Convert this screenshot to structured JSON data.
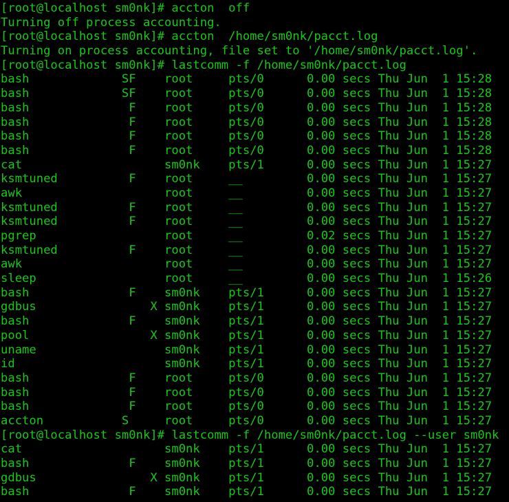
{
  "colors": {
    "background": "#000000",
    "text": "#17c917"
  },
  "prompt": "[root@localhost sm0nk]# ",
  "blocks": [
    {
      "type": "cmd",
      "text": "accton  off"
    },
    {
      "type": "out",
      "text": "Turning off process accounting."
    },
    {
      "type": "cmd",
      "text": "accton  /home/sm0nk/pacct.log"
    },
    {
      "type": "out",
      "text": "Turning on process accounting, file set to '/home/sm0nk/pacct.log'."
    },
    {
      "type": "cmd",
      "text": "lastcomm -f /home/sm0nk/pacct.log"
    },
    {
      "type": "rows",
      "rows": [
        [
          "bash",
          "SF",
          "root",
          "pts/0",
          "0.00",
          "Thu Jun  1 15:28"
        ],
        [
          "bash",
          "SF",
          "root",
          "pts/0",
          "0.00",
          "Thu Jun  1 15:28"
        ],
        [
          "bash",
          " F",
          "root",
          "pts/0",
          "0.00",
          "Thu Jun  1 15:28"
        ],
        [
          "bash",
          " F",
          "root",
          "pts/0",
          "0.00",
          "Thu Jun  1 15:28"
        ],
        [
          "bash",
          " F",
          "root",
          "pts/0",
          "0.00",
          "Thu Jun  1 15:28"
        ],
        [
          "bash",
          " F",
          "root",
          "pts/0",
          "0.00",
          "Thu Jun  1 15:28"
        ],
        [
          "cat",
          "",
          "sm0nk",
          "pts/1",
          "0.00",
          "Thu Jun  1 15:27"
        ],
        [
          "ksmtuned",
          " F",
          "root",
          "__",
          "0.00",
          "Thu Jun  1 15:27"
        ],
        [
          "awk",
          "",
          "root",
          "__",
          "0.00",
          "Thu Jun  1 15:27"
        ],
        [
          "ksmtuned",
          " F",
          "root",
          "__",
          "0.00",
          "Thu Jun  1 15:27"
        ],
        [
          "ksmtuned",
          " F",
          "root",
          "__",
          "0.00",
          "Thu Jun  1 15:27"
        ],
        [
          "pgrep",
          "",
          "root",
          "__",
          "0.02",
          "Thu Jun  1 15:27"
        ],
        [
          "ksmtuned",
          " F",
          "root",
          "__",
          "0.00",
          "Thu Jun  1 15:27"
        ],
        [
          "awk",
          "",
          "root",
          "__",
          "0.00",
          "Thu Jun  1 15:27"
        ],
        [
          "sleep",
          "",
          "root",
          "__",
          "0.00",
          "Thu Jun  1 15:26"
        ],
        [
          "bash",
          " F",
          "sm0nk",
          "pts/1",
          "0.00",
          "Thu Jun  1 15:27"
        ],
        [
          "gdbus",
          "    X",
          "sm0nk",
          "pts/1",
          "0.00",
          "Thu Jun  1 15:27"
        ],
        [
          "bash",
          " F",
          "sm0nk",
          "pts/1",
          "0.00",
          "Thu Jun  1 15:27"
        ],
        [
          "pool",
          "    X",
          "sm0nk",
          "pts/1",
          "0.00",
          "Thu Jun  1 15:27"
        ],
        [
          "uname",
          "",
          "sm0nk",
          "pts/1",
          "0.00",
          "Thu Jun  1 15:27"
        ],
        [
          "id",
          "",
          "sm0nk",
          "pts/1",
          "0.00",
          "Thu Jun  1 15:27"
        ],
        [
          "bash",
          " F",
          "root",
          "pts/0",
          "0.00",
          "Thu Jun  1 15:27"
        ],
        [
          "bash",
          " F",
          "root",
          "pts/0",
          "0.00",
          "Thu Jun  1 15:27"
        ],
        [
          "bash",
          " F",
          "root",
          "pts/0",
          "0.00",
          "Thu Jun  1 15:27"
        ],
        [
          "accton",
          "S",
          "root",
          "pts/0",
          "0.00",
          "Thu Jun  1 15:27"
        ]
      ]
    },
    {
      "type": "cmd",
      "text": "lastcomm -f /home/sm0nk/pacct.log --user sm0nk"
    },
    {
      "type": "rows",
      "rows": [
        [
          "cat",
          "",
          "sm0nk",
          "pts/1",
          "0.00",
          "Thu Jun  1 15:27"
        ],
        [
          "bash",
          " F",
          "sm0nk",
          "pts/1",
          "0.00",
          "Thu Jun  1 15:27"
        ],
        [
          "gdbus",
          "    X",
          "sm0nk",
          "pts/1",
          "0.00",
          "Thu Jun  1 15:27"
        ],
        [
          "bash",
          " F",
          "sm0nk",
          "pts/1",
          "0.00",
          "Thu Jun  1 15:27"
        ]
      ]
    }
  ],
  "secs_label": "secs"
}
